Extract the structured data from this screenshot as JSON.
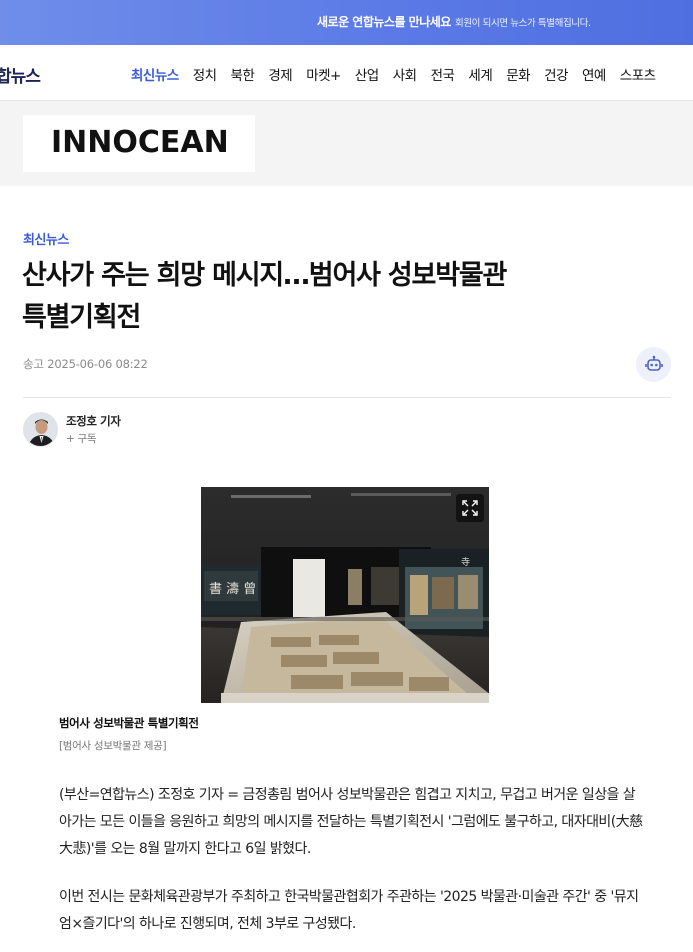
{
  "promo": {
    "title": "새로운 연합뉴스를 만나세요",
    "subtitle": "회원이 되시면 뉴스가 특별해집니다."
  },
  "header": {
    "logo": "합뉴스",
    "menu": [
      "최신뉴스",
      "정치",
      "북한",
      "경제",
      "마켓+",
      "산업",
      "사회",
      "전국",
      "세계",
      "문화",
      "건강",
      "연예",
      "스포츠"
    ]
  },
  "ad": {
    "brand": "INNOCEAN"
  },
  "article": {
    "category": "최신뉴스",
    "title_line1": "산사가 주는 희망 메시지…범어사 성보박물관",
    "title_line2": "특별기획전",
    "sent_label": "송고",
    "sent_time": "2025-06-06 08:22",
    "reporter": "조정호 기자",
    "subscribe": "+ 구독",
    "photo_caption": "범어사 성보박물관 특별기획전",
    "photo_credit": "[범어사 성보박물관 제공]",
    "body": [
      "(부산=연합뉴스) 조정호 기자 = 금정총림 범어사 성보박물관은 힘겹고 지치고, 무겁고 버거운 일상을 살아가는 모든 이들을 응원하고 희망의 메시지를 전달하는 특별기획전시 '그럼에도 불구하고, 대자대비(大慈大悲)'를 오는 8월 말까지 한다고 6일 밝혔다.",
      "이번 전시는 문화체육관광부가 주최하고 한국박물관협회가 주관하는 '2025 박물관·미술관 주간' 중 '뮤지엄×즐기다'의 하나로 진행되며, 전체 3부로 구성됐다."
    ]
  },
  "colors": {
    "accent": "#3b5bd6",
    "promo_bg": "#5a79e6",
    "ad_band": "#f4f4f4"
  }
}
